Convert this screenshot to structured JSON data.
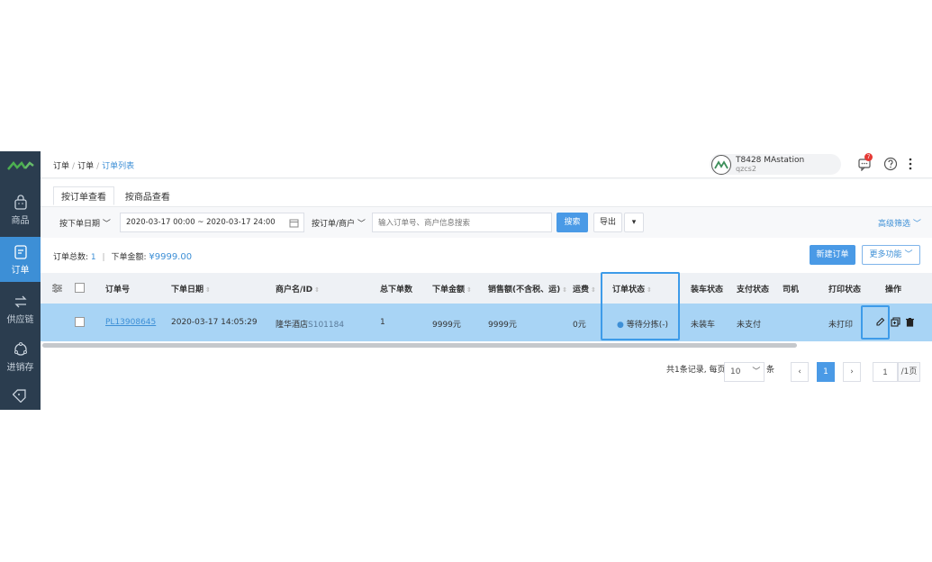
{
  "sidebar": {
    "items": [
      {
        "label": "商品",
        "icon": "bag-icon"
      },
      {
        "label": "订单",
        "icon": "order-icon",
        "active": true
      },
      {
        "label": "供应链",
        "icon": "exchange-icon"
      },
      {
        "label": "进销存",
        "icon": "stock-icon"
      },
      {
        "label": "",
        "icon": "tag-icon"
      }
    ]
  },
  "breadcrumb": [
    "订单",
    "订单",
    "订单列表"
  ],
  "user": {
    "name": "T8428 MAstation",
    "sub": "qzcs2",
    "notification_count": "7"
  },
  "tabs": [
    "按订单查看",
    "按商品查看"
  ],
  "filters": {
    "date_type": "按下单日期",
    "date_range": "2020-03-17 00:00 ~ 2020-03-17 24:00",
    "search_type": "按订单/商户",
    "search_placeholder": "输入订单号、商户信息搜索",
    "search_button": "搜索",
    "export_button": "导出",
    "advanced": "高级筛选"
  },
  "summary": {
    "total_label": "订单总数:",
    "total_value": "1",
    "amount_label": "下单金额:",
    "amount_value": "¥9999.00",
    "new_order_button": "新建订单",
    "more_button": "更多功能"
  },
  "table": {
    "headers": [
      "订单号",
      "下单日期",
      "商户名/ID",
      "总下单数",
      "下单金额",
      "销售额(不含税、运)",
      "运费",
      "订单状态",
      "装车状态",
      "支付状态",
      "司机",
      "打印状态",
      "操作"
    ],
    "row": {
      "order_no": "PL13908645",
      "date": "2020-03-17 14:05:29",
      "merchant": "隆华酒店",
      "merchant_id": "S101184",
      "count": "1",
      "amount": "9999元",
      "sales": "9999元",
      "freight": "0元",
      "status": "等待分拣(-)",
      "load_status": "未装车",
      "pay_status": "未支付",
      "driver": "",
      "print_status": "未打印"
    }
  },
  "pagination": {
    "info": "共1条记录, 每页",
    "page_size": "10",
    "unit": "条",
    "current": "1",
    "jump_value": "1",
    "total_pages": "/1页"
  },
  "colors": {
    "accent": "#4a9ae6",
    "sidebar": "#2b3d4f",
    "row_selected": "#a8d4f5",
    "highlight": "#3d9be9"
  }
}
